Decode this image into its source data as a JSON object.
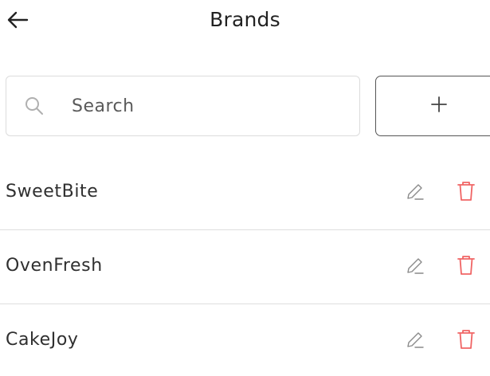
{
  "header": {
    "title": "Brands",
    "back_icon": "arrow-left-icon"
  },
  "search": {
    "placeholder": "Search",
    "value": "",
    "icon": "search-icon"
  },
  "add_button": {
    "icon": "plus-icon"
  },
  "brands": [
    {
      "name": "SweetBite"
    },
    {
      "name": "OvenFresh"
    },
    {
      "name": "CakeJoy"
    }
  ],
  "row_actions": {
    "edit_icon": "pencil-icon",
    "delete_icon": "trash-icon"
  },
  "colors": {
    "delete": "#f06565",
    "edit": "#8a8a8a",
    "border": "#dcdcdc",
    "text": "#2f2f2f"
  }
}
